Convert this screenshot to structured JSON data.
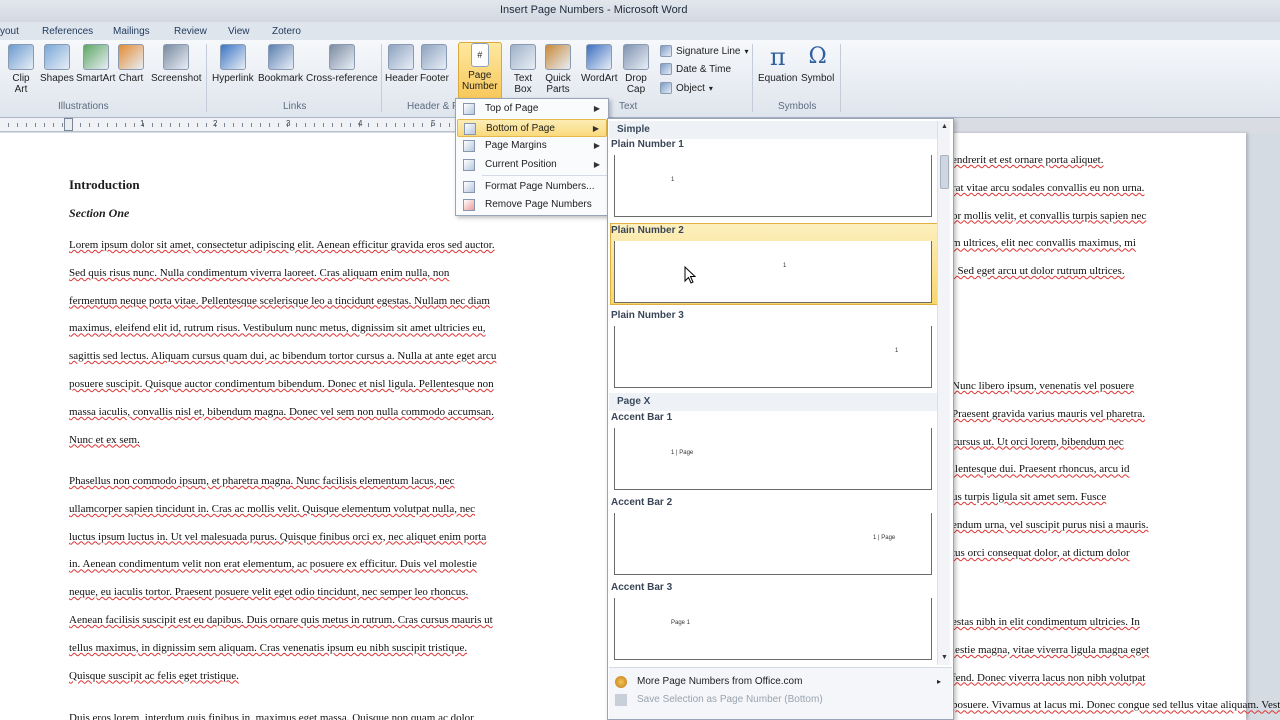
{
  "window": {
    "title": "Insert Page Numbers - Microsoft Word"
  },
  "tabs": [
    "yout",
    "References",
    "Mailings",
    "Review",
    "View",
    "Zotero"
  ],
  "ribbon": {
    "buttons": [
      {
        "label": "Clip\nArt",
        "icon": "clip-art-icon"
      },
      {
        "label": "Shapes",
        "icon": "shapes-icon"
      },
      {
        "label": "SmartArt",
        "icon": "smartart-icon"
      },
      {
        "label": "Chart",
        "icon": "chart-icon"
      },
      {
        "label": "Screenshot",
        "icon": "screenshot-icon"
      },
      {
        "label": "Hyperlink",
        "icon": "hyperlink-icon"
      },
      {
        "label": "Bookmark",
        "icon": "bookmark-icon"
      },
      {
        "label": "Cross-reference",
        "icon": "cross-reference-icon"
      },
      {
        "label": "Header",
        "icon": "header-icon"
      },
      {
        "label": "Footer",
        "icon": "footer-icon"
      },
      {
        "label": "Page\nNumber",
        "icon": "page-number-icon"
      },
      {
        "label": "Text\nBox",
        "icon": "text-box-icon"
      },
      {
        "label": "Quick\nParts",
        "icon": "quick-parts-icon"
      },
      {
        "label": "WordArt",
        "icon": "wordart-icon"
      },
      {
        "label": "Drop\nCap",
        "icon": "drop-cap-icon"
      },
      {
        "label": "Equation",
        "icon": "equation-icon"
      },
      {
        "label": "Symbol",
        "icon": "symbol-icon"
      }
    ],
    "small": {
      "signature_line": "Signature Line",
      "date_time": "Date & Time",
      "object": "Object"
    },
    "groups": {
      "illustrations": "Illustrations",
      "links": "Links",
      "header_footer": "Header & F",
      "text": "Text",
      "symbols": "Symbols"
    }
  },
  "ruler": {
    "numbers": [
      "1",
      "2",
      "3",
      "4",
      "5"
    ]
  },
  "menu": {
    "items": [
      "Top of Page",
      "Bottom of Page",
      "Page Margins",
      "Current Position",
      "Format Page Numbers...",
      "Remove Page Numbers"
    ],
    "selected": "Bottom of Page"
  },
  "gallery": {
    "category_simple": "Simple",
    "category_pagex": "Page X",
    "items": [
      {
        "label": "Plain Number 1",
        "mark": "1"
      },
      {
        "label": "Plain Number 2",
        "mark": "1"
      },
      {
        "label": "Plain Number 3",
        "mark": "1"
      },
      {
        "label": "Accent Bar 1",
        "mark": "1 | Page"
      },
      {
        "label": "Accent Bar 2",
        "mark": "1 | Page"
      },
      {
        "label": "Accent Bar 3",
        "mark": "Page 1"
      }
    ],
    "highlighted": "Plain Number 2",
    "footer": {
      "more": "More Page Numbers from Office.com",
      "save": "Save Selection as Page Number (Bottom)"
    }
  },
  "document": {
    "heading": "Introduction",
    "subheading": "Section One",
    "para1_lines": [
      "Lorem ipsum dolor sit amet, consectetur adipiscing elit. Aenean efficitur gravida eros sed auctor.",
      "Sed quis risus nunc. Nulla condimentum viverra laoreet. Cras aliquam enim nulla, non",
      "fermentum neque porta vitae. Pellentesque scelerisque leo a tincidunt egestas. Nullam nec diam",
      "maximus, eleifend elit id, rutrum risus. Vestibulum nunc metus, dignissim sit amet ultricies eu,",
      "sagittis sed lectus. Aliquam cursus quam dui, ac bibendum tortor cursus a. Nulla at ante eget arcu",
      "posuere suscipit. Quisque auctor condimentum bibendum. Donec et nisl ligula. Pellentesque non",
      "massa iaculis, convallis nisl et, bibendum magna. Donec vel sem non nulla commodo accumsan.",
      "Nunc et ex sem."
    ],
    "para2_lines": [
      "Phasellus non commodo ipsum, et pharetra magna. Nunc facilisis elementum lacus, nec",
      "ullamcorper sapien tincidunt in. Cras ac mollis velit. Quisque elementum volutpat nulla, nec",
      "luctus ipsum luctus in. Ut vel malesuada purus. Quisque finibus orci ex, nec aliquet enim porta",
      "in. Aenean condimentum velit non erat elementum, ac posuere ex efficitur. Duis vel molestie",
      "neque, eu iaculis tortor. Praesent posuere velit eget odio tincidunt, nec semper leo rhoncus.",
      "Aenean facilisis suscipit est eu dapibus. Duis ornare quis metus in rutrum. Cras cursus mauris ut",
      "tellus maximus, in dignissim sem aliquam. Cras venenatis ipsum eu nibh suscipit tristique.",
      "Quisque suscipit ac felis eget tristique."
    ],
    "para3_partial": "Duis eros lorem, interdum quis finibus in, maximus eget massa. Quisque non quam ac dolor",
    "right_lines_a": [
      "endrerit et est ornare porta aliquet.",
      "rat vitae arcu sodales convallis eu non urna.",
      "or mollis velit, et convallis turpis sapien nec",
      "m ultrices, elit nec convallis maximus, mi",
      ". Sed eget arcu ut dolor rutrum ultrices."
    ],
    "right_lines_b": [
      "Nunc libero ipsum, venenatis vel posuere",
      "Praesent gravida varius mauris vel pharetra.",
      "cursus ut. Ut orci lorem, bibendum nec",
      "llentesque dui. Praesent rhoncus, arcu id",
      "us turpis ligula sit amet sem. Fusce",
      "endum urna, vel suscipit purus nisi a mauris.",
      "tus orci consequat dolor, at dictum dolor"
    ],
    "right_lines_c": [
      "estas nibh in elit condimentum ultricies. In",
      "lestie magna, vitae viverra ligula magna eget",
      "fend. Donec viverra lacus non nibh volutpat",
      "posuere. Vivamus at lacus mi. Donec congue sed tellus vitae aliquam. Vestibulum luctus"
    ]
  },
  "colors": {
    "ribbon_bg": "#dfe5ed",
    "highlight": "#f8d76c",
    "squiggle": "#dd3333"
  }
}
